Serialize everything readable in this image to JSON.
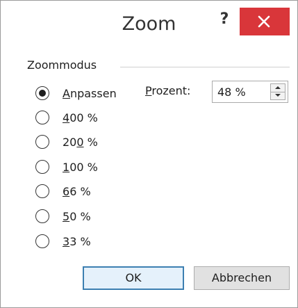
{
  "window": {
    "title": "Zoom",
    "help_label": "?",
    "close_icon": "close-icon"
  },
  "group": {
    "label": "Zoommodus"
  },
  "options": [
    {
      "prefix": "",
      "mnemonic": "A",
      "suffix": "npassen",
      "checked": true
    },
    {
      "prefix": "",
      "mnemonic": "4",
      "suffix": "00 %",
      "checked": false
    },
    {
      "prefix": "20",
      "mnemonic": "0",
      "suffix": " %",
      "checked": false
    },
    {
      "prefix": "",
      "mnemonic": "1",
      "suffix": "00 %",
      "checked": false
    },
    {
      "prefix": "",
      "mnemonic": "6",
      "suffix": "6 %",
      "checked": false
    },
    {
      "prefix": "",
      "mnemonic": "5",
      "suffix": "0 %",
      "checked": false
    },
    {
      "prefix": "",
      "mnemonic": "3",
      "suffix": "3 %",
      "checked": false
    }
  ],
  "percent": {
    "label_mnemonic": "P",
    "label_rest": "rozent:",
    "value": "48 %"
  },
  "buttons": {
    "ok": "OK",
    "cancel": "Abbrechen"
  },
  "colors": {
    "close_bg": "#d9363a",
    "default_border": "#3c7fb1"
  }
}
